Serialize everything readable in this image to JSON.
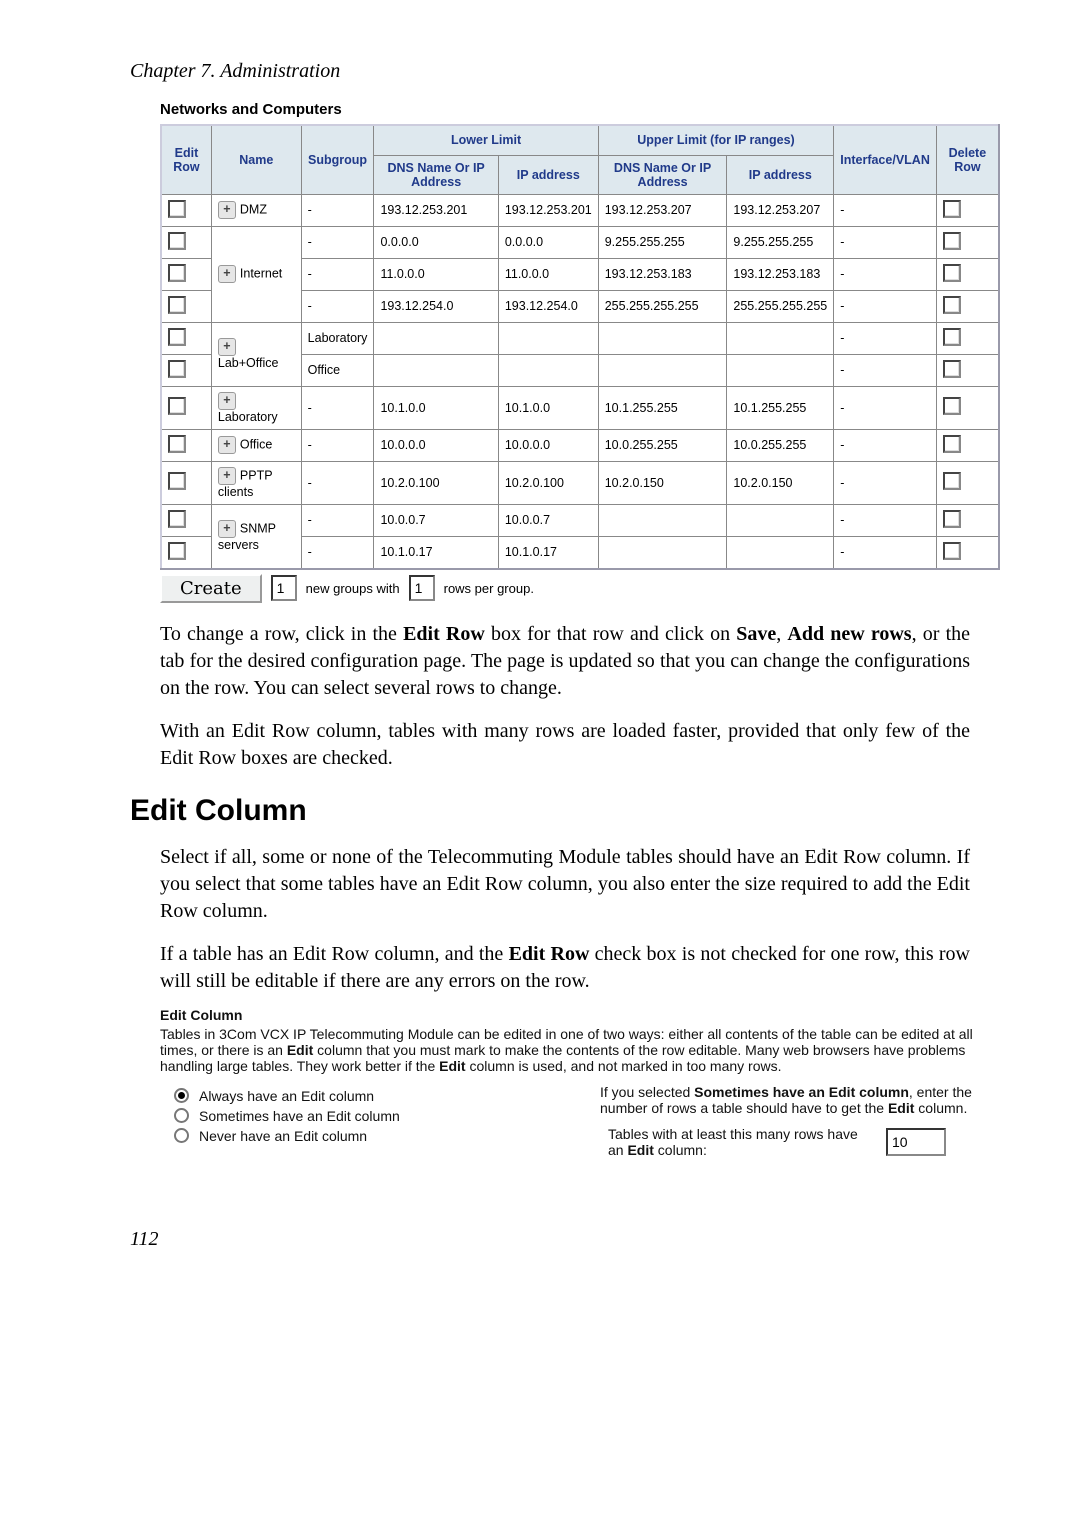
{
  "chapter_title": "Chapter 7. Administration",
  "section_title": "Networks and Computers",
  "table": {
    "headers": {
      "edit_row": "Edit Row",
      "name": "Name",
      "subgroup": "Subgroup",
      "lower_limit": "Lower Limit",
      "lower_dns": "DNS Name Or IP Address",
      "lower_ip": "IP address",
      "upper_limit": "Upper Limit (for IP ranges)",
      "upper_dns": "DNS Name Or IP Address",
      "upper_ip": "IP address",
      "iface": "Interface/VLAN",
      "delete_row": "Delete Row"
    },
    "rows": [
      {
        "name": "DMZ",
        "sub": "-",
        "ld": "193.12.253.201",
        "li": "193.12.253.201",
        "ud": "193.12.253.207",
        "ui": "193.12.253.207",
        "if": "-"
      },
      {
        "name": "",
        "sub": "-",
        "ld": "0.0.0.0",
        "li": "0.0.0.0",
        "ud": "9.255.255.255",
        "ui": "9.255.255.255",
        "if": "-"
      },
      {
        "name": "Internet",
        "sub": "-",
        "ld": "11.0.0.0",
        "li": "11.0.0.0",
        "ud": "193.12.253.183",
        "ui": "193.12.253.183",
        "if": "-"
      },
      {
        "name": "",
        "sub": "-",
        "ld": "193.12.254.0",
        "li": "193.12.254.0",
        "ud": "255.255.255.255",
        "ui": "255.255.255.255",
        "if": "-"
      },
      {
        "name": "",
        "sub": "Laboratory",
        "ld": "",
        "li": "",
        "ud": "",
        "ui": "",
        "if": "-"
      },
      {
        "name": "Lab+Office",
        "sub": "Office",
        "ld": "",
        "li": "",
        "ud": "",
        "ui": "",
        "if": "-"
      },
      {
        "name": "Laboratory",
        "sub": "-",
        "ld": "10.1.0.0",
        "li": "10.1.0.0",
        "ud": "10.1.255.255",
        "ui": "10.1.255.255",
        "if": "-"
      },
      {
        "name": "Office",
        "sub": "-",
        "ld": "10.0.0.0",
        "li": "10.0.0.0",
        "ud": "10.0.255.255",
        "ui": "10.0.255.255",
        "if": "-"
      },
      {
        "name": "PPTP clients",
        "sub": "-",
        "ld": "10.2.0.100",
        "li": "10.2.0.100",
        "ud": "10.2.0.150",
        "ui": "10.2.0.150",
        "if": "-"
      },
      {
        "name": "",
        "sub": "-",
        "ld": "10.0.0.7",
        "li": "10.0.0.7",
        "ud": "",
        "ui": "",
        "if": "-"
      },
      {
        "name": "SNMP servers",
        "sub": "-",
        "ld": "10.1.0.17",
        "li": "10.1.0.17",
        "ud": "",
        "ui": "",
        "if": "-"
      }
    ]
  },
  "create_row": {
    "create_btn": "Create",
    "count": "1",
    "text1": "new groups with",
    "rows_per_group": "1",
    "text2": "rows per group."
  },
  "para1_a": "To change a row, click in the ",
  "para1_b": "Edit Row",
  "para1_c": " box for that row and click on ",
  "para1_d": "Save",
  "para1_e": ", ",
  "para1_f": "Add new rows",
  "para1_g": ", or the tab for the desired configuration page. The page is updated so that you can change the configurations on the row. You can select several rows to change.",
  "para2": "With an Edit Row column, tables with many rows are loaded faster, provided that only few of the Edit Row boxes are checked.",
  "h2": "Edit Column",
  "para3": "Select if all, some or none of the Telecommuting Module tables should have an Edit Row column. If you select that some tables have an Edit Row column, you also enter the size required to add the Edit Row column.",
  "para4_a": "If a table has an Edit Row column, and the ",
  "para4_b": "Edit Row",
  "para4_c": " check box is not checked for one row, this row will still be editable if there are any errors on the row.",
  "ec": {
    "title": "Edit Column",
    "desc_a": "Tables in 3Com VCX IP Telecommuting Module can be edited in one of two ways: either all contents of the table can be edited at all times, or there is an ",
    "desc_b": "Edit",
    "desc_c": " column that you must mark to make the contents of the row editable. Many web browsers have problems handling large tables. They work better if the ",
    "desc_d": "Edit",
    "desc_e": " column is used, and not marked in too many rows.",
    "opt1": "Always have an Edit column",
    "opt2": "Sometimes have an Edit column",
    "opt3": "Never have an Edit column",
    "right_a": "If you selected ",
    "right_b": "Sometimes have an Edit column",
    "right_c": ", enter the number of rows a table should have to get the ",
    "right_d": "Edit",
    "right_e": " column.",
    "rows_label_a": "Tables with at least this many rows have an ",
    "rows_label_b": "Edit",
    "rows_label_c": " column:",
    "rows_val": "10"
  },
  "page_number": "112"
}
